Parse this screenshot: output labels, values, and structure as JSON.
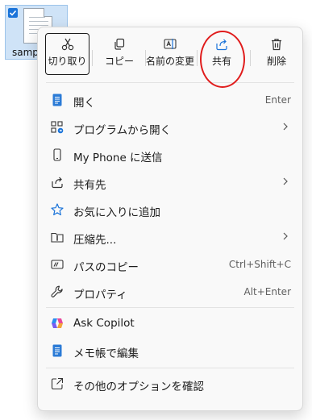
{
  "desktop": {
    "file_name": "samp"
  },
  "toolbar": {
    "cut": "切り取り",
    "copy": "コピー",
    "rename": "名前の変更",
    "share": "共有",
    "delete": "削除"
  },
  "menu": {
    "items": [
      {
        "label": "開く",
        "shortcut": "Enter",
        "icon": "notepad-icon"
      },
      {
        "label": "プログラムから開く",
        "shortcut": "",
        "icon": "open-with-icon",
        "submenu": true
      },
      {
        "label": "My Phone に送信",
        "shortcut": "",
        "icon": "phone-icon"
      },
      {
        "label": "共有先",
        "shortcut": "",
        "icon": "share-icon",
        "submenu": true
      },
      {
        "label": "お気に入りに追加",
        "shortcut": "",
        "icon": "star-icon"
      },
      {
        "label": "圧縮先...",
        "shortcut": "",
        "icon": "zip-folder-icon",
        "submenu": true
      },
      {
        "label": "パスのコピー",
        "shortcut": "Ctrl+Shift+C",
        "icon": "copy-path-icon"
      },
      {
        "label": "プロパティ",
        "shortcut": "Alt+Enter",
        "icon": "wrench-icon"
      },
      {
        "label": "Ask Copilot",
        "shortcut": "",
        "icon": "copilot-icon"
      },
      {
        "label": "メモ帳で編集",
        "shortcut": "",
        "icon": "notepad-icon"
      },
      {
        "label": "その他のオプションを確認",
        "shortcut": "",
        "icon": "more-options-icon"
      }
    ]
  },
  "colors": {
    "accent": "#1a73d9",
    "highlight_circle": "#e01c1c"
  }
}
